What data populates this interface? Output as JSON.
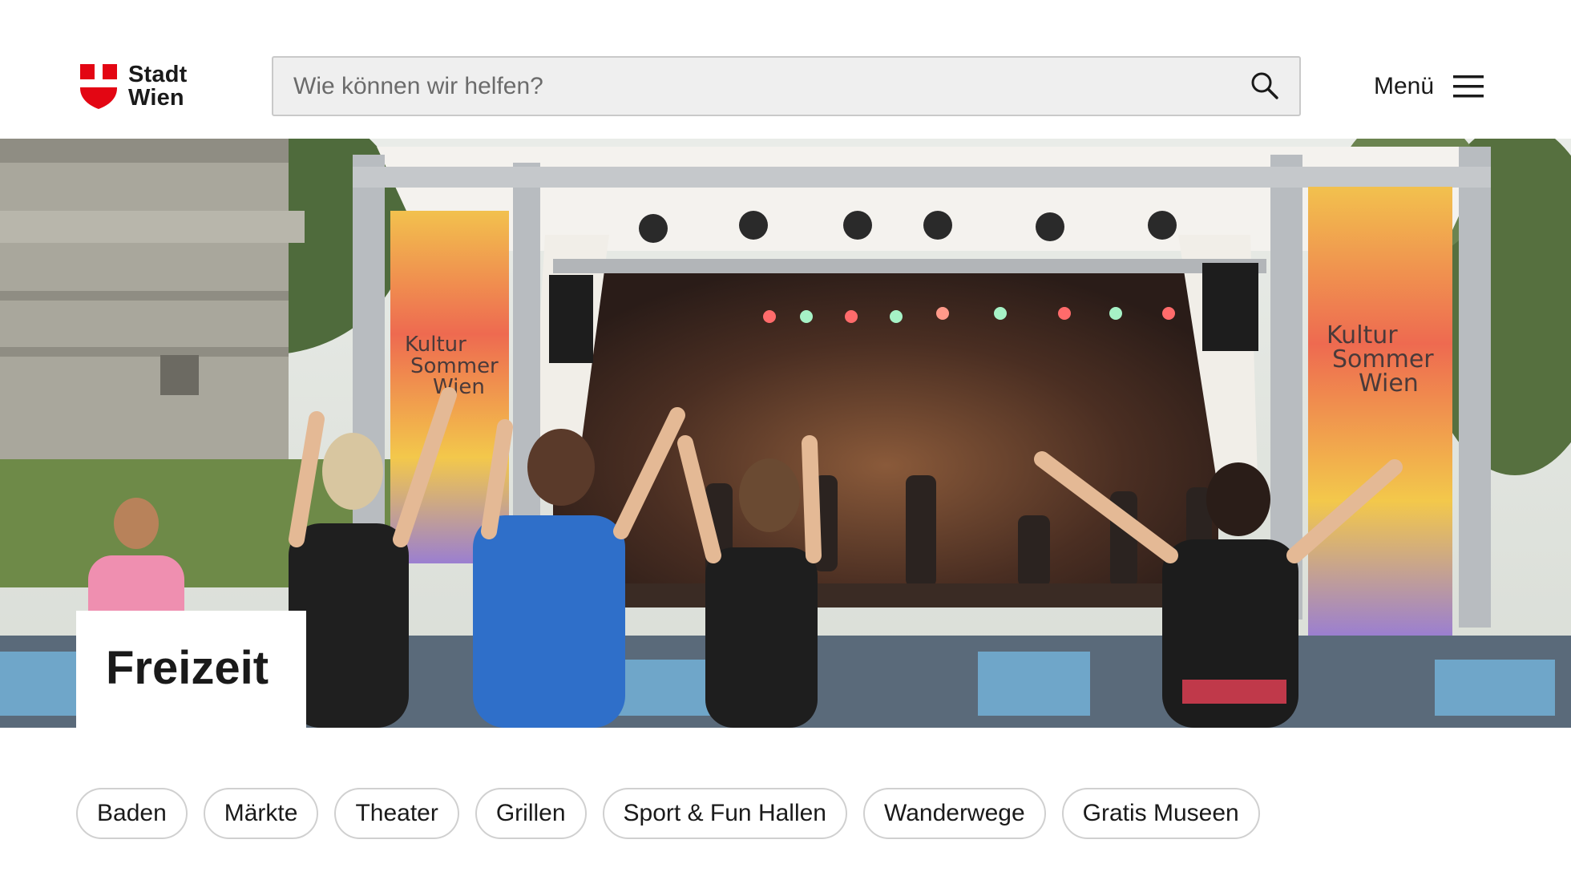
{
  "header": {
    "logo": {
      "line1": "Stadt",
      "line2": "Wien",
      "icon": "vienna-shield-icon",
      "color": "#e30613"
    },
    "search": {
      "placeholder": "Wie können wir helfen?",
      "value": "",
      "icon": "search-icon"
    },
    "menu": {
      "label": "Menü",
      "icon": "hamburger-menu-icon"
    }
  },
  "hero": {
    "title": "Freizeit",
    "banner_text": "Kultur Sommer Wien"
  },
  "chips": [
    {
      "label": "Baden"
    },
    {
      "label": "Märkte"
    },
    {
      "label": "Theater"
    },
    {
      "label": "Grillen"
    },
    {
      "label": "Sport & Fun Hallen"
    },
    {
      "label": "Wanderwege"
    },
    {
      "label": "Gratis Museen"
    }
  ],
  "colors": {
    "accent": "#e30613",
    "chip_border": "#d0d0d0",
    "search_bg": "#efefef"
  }
}
